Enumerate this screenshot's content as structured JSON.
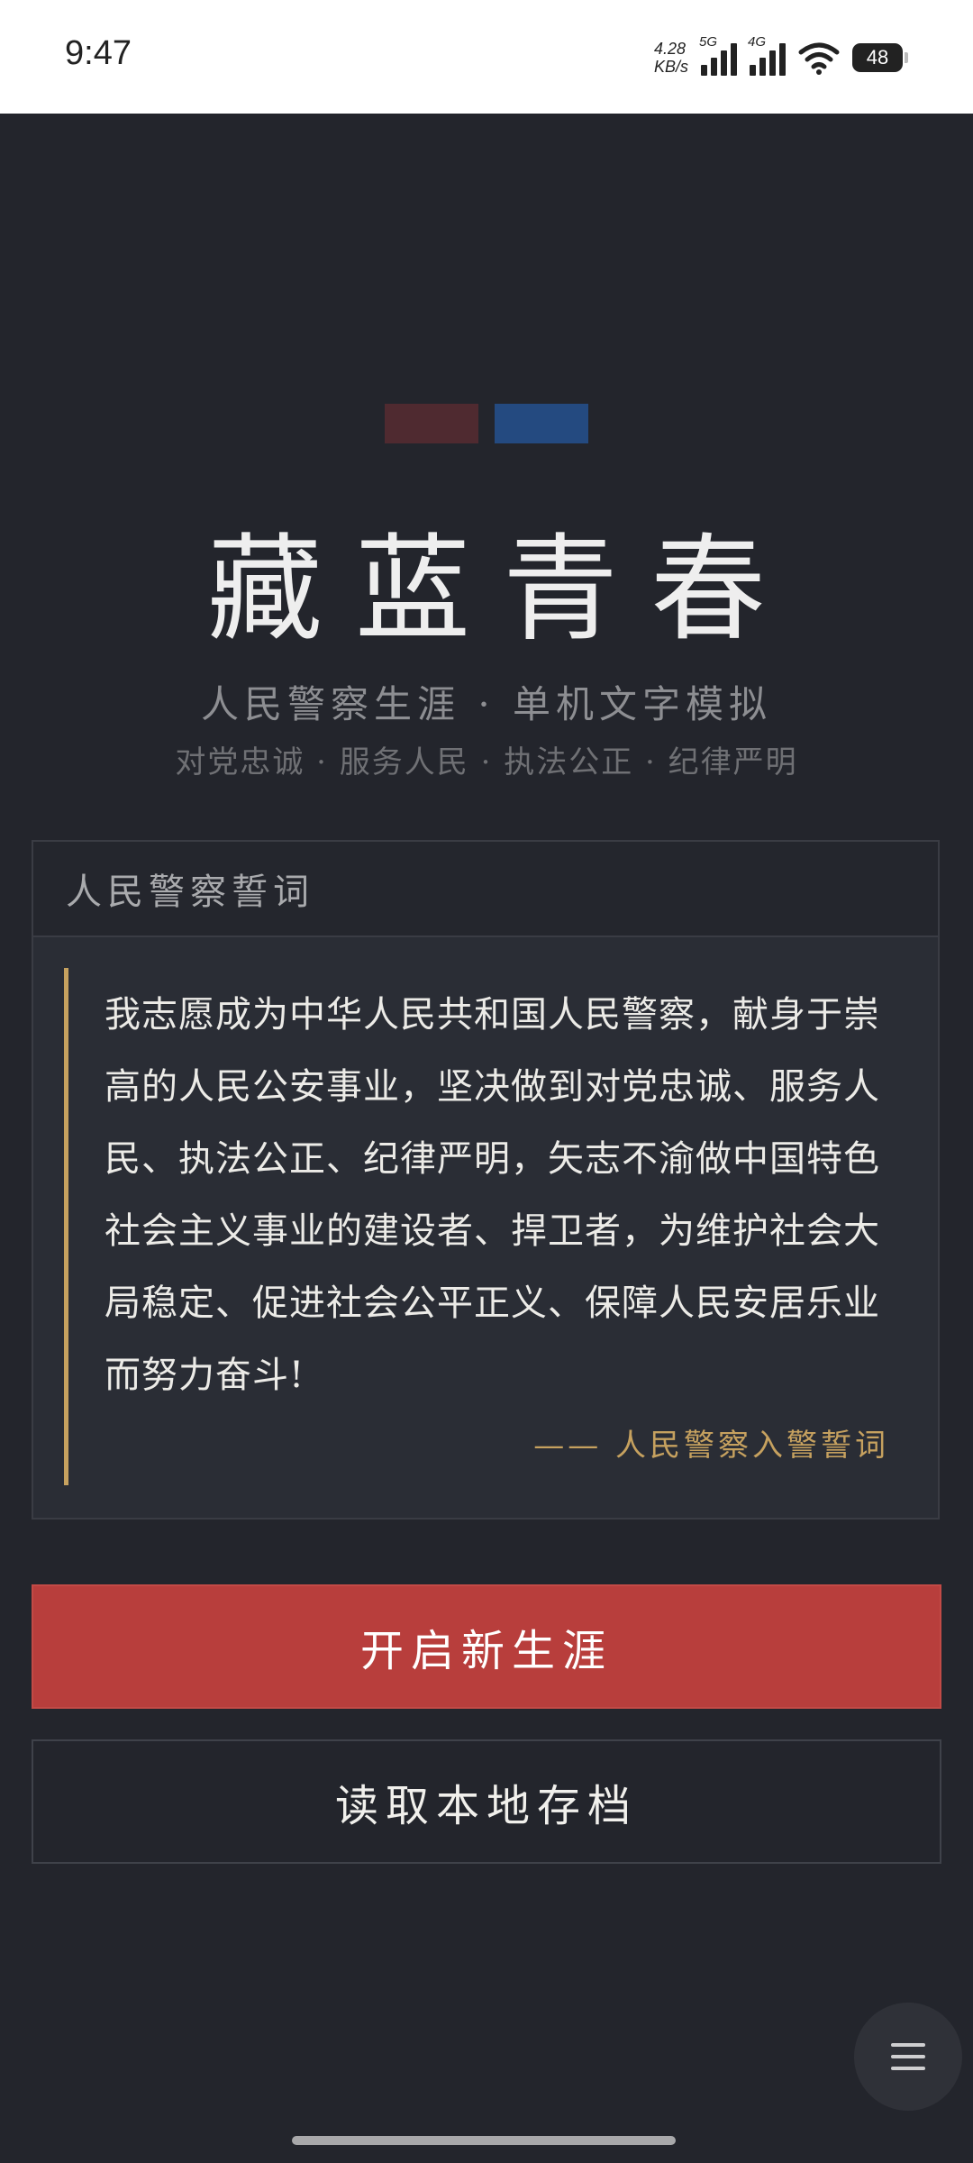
{
  "status_bar": {
    "time": "9:47",
    "net_speed_value": "4.28",
    "net_speed_unit": "KB/s",
    "signal1_tag": "5G",
    "signal2_tag": "4G",
    "battery": "48"
  },
  "header": {
    "title": "藏蓝青春",
    "subtitle": "人民警察生涯 · 单机文字模拟",
    "motto": "对党忠诚 · 服务人民 · 执法公正 · 纪律严明",
    "flag_colors": [
      "#4f2a30",
      "#244a80"
    ]
  },
  "oath_card": {
    "heading": "人民警察誓词",
    "text": "我志愿成为中华人民共和国人民警察，献身于崇高的人民公安事业，坚决做到对党忠诚、服务人民、执法公正、纪律严明，矢志不渝做中国特色社会主义事业的建设者、捍卫者，为维护社会大局稳定、促进社会公平正义、保障人民安居乐业而努力奋斗!",
    "source": "—— 人民警察入警誓词"
  },
  "actions": {
    "new_career": "开启新生涯",
    "load_save": "读取本地存档"
  },
  "colors": {
    "primary_button": "#b83e3c",
    "accent_gold": "#c6a15f",
    "background": "#23252c"
  },
  "icons": {
    "menu": "hamburger-menu-icon"
  }
}
